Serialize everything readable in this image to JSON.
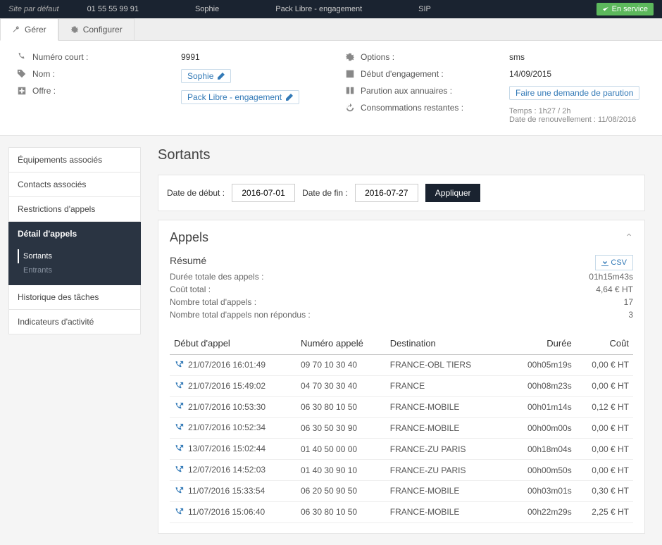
{
  "topbar": {
    "site": "Site par défaut",
    "phone": "01 55 55 99 91",
    "user": "Sophie",
    "pack": "Pack Libre - engagement",
    "protocol": "SIP",
    "status": "En service"
  },
  "tabs": {
    "manage": "Gérer",
    "configure": "Configurer"
  },
  "details": {
    "short_number_label": "Numéro court :",
    "short_number": "9991",
    "name_label": "Nom :",
    "name": "Sophie",
    "offer_label": "Offre :",
    "offer": "Pack Libre - engagement",
    "options_label": "Options :",
    "options": "sms",
    "engagement_label": "Début d'engagement :",
    "engagement": "14/09/2015",
    "directory_label": "Parution aux annuaires :",
    "directory_link": "Faire une demande de parution",
    "consumption_label": "Consommations restantes :",
    "consumption_time": "Temps : 1h27 / 2h",
    "consumption_renewal": "Date de renouvellement : 11/08/2016"
  },
  "sidebar": {
    "items": [
      "Équipements associés",
      "Contacts associés",
      "Restrictions d'appels",
      "Détail d'appels",
      "Historique des tâches",
      "Indicateurs d'activité"
    ],
    "sub": {
      "outgoing": "Sortants",
      "incoming": "Entrants"
    }
  },
  "page": {
    "title": "Sortants"
  },
  "filter": {
    "start_label": "Date de début :",
    "start_value": "2016-07-01",
    "end_label": "Date de fin :",
    "end_value": "2016-07-27",
    "apply": "Appliquer"
  },
  "panel": {
    "title": "Appels",
    "csv": "CSV",
    "summary_title": "Résumé",
    "rows": [
      {
        "label": "Durée totale des appels :",
        "value": "01h15m43s"
      },
      {
        "label": "Coût total :",
        "value": "4,64 € HT"
      },
      {
        "label": "Nombre total d'appels :",
        "value": "17"
      },
      {
        "label": "Nombre total d'appels non répondus :",
        "value": "3"
      }
    ]
  },
  "table": {
    "headers": [
      "Début d'appel",
      "Numéro appelé",
      "Destination",
      "Durée",
      "Coût"
    ],
    "rows": [
      {
        "start": "21/07/2016 16:01:49",
        "number": "09 70 10 30 40",
        "dest": "FRANCE-OBL TIERS",
        "duration": "00h05m19s",
        "cost": "0,00 € HT"
      },
      {
        "start": "21/07/2016 15:49:02",
        "number": "04 70 30 30 40",
        "dest": "FRANCE",
        "duration": "00h08m23s",
        "cost": "0,00 € HT"
      },
      {
        "start": "21/07/2016 10:53:30",
        "number": "06 30 80 10 50",
        "dest": "FRANCE-MOBILE",
        "duration": "00h01m14s",
        "cost": "0,12 € HT"
      },
      {
        "start": "21/07/2016 10:52:34",
        "number": "06 30 50 30 90",
        "dest": "FRANCE-MOBILE",
        "duration": "00h00m00s",
        "cost": "0,00 € HT"
      },
      {
        "start": "13/07/2016 15:02:44",
        "number": "01 40 50 00 00",
        "dest": "FRANCE-ZU PARIS",
        "duration": "00h18m04s",
        "cost": "0,00 € HT"
      },
      {
        "start": "12/07/2016 14:52:03",
        "number": "01 40 30 90 10",
        "dest": "FRANCE-ZU PARIS",
        "duration": "00h00m50s",
        "cost": "0,00 € HT"
      },
      {
        "start": "11/07/2016 15:33:54",
        "number": "06 20 50 90 50",
        "dest": "FRANCE-MOBILE",
        "duration": "00h03m01s",
        "cost": "0,30 € HT"
      },
      {
        "start": "11/07/2016 15:06:40",
        "number": "06 30 80 10 50",
        "dest": "FRANCE-MOBILE",
        "duration": "00h22m29s",
        "cost": "2,25 € HT"
      }
    ]
  }
}
